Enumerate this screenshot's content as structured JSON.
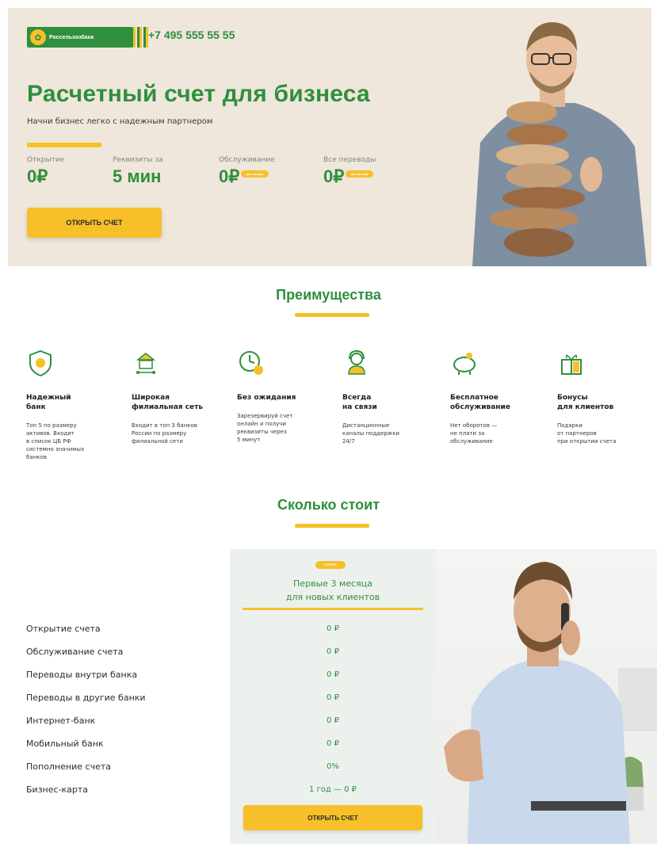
{
  "colors": {
    "brand_green": "#2f8f3c",
    "accent_yellow": "#f7c02a",
    "hero_bg": "#efe6dc",
    "panel_bg": "#edf1ee"
  },
  "header": {
    "logo_text": "Россельхозбанк",
    "phone": "+7 495 555 55 55"
  },
  "hero": {
    "title": "Расчетный счет для бизнеса",
    "subtitle": "Начни бизнес легко с надежным партнером",
    "stats": [
      {
        "label": "Открытие",
        "value": "0₽",
        "badge": ""
      },
      {
        "label": "Реквизиты за",
        "value": "5 мин",
        "badge": ""
      },
      {
        "label": "Обслуживание",
        "value": "0₽",
        "badge": "три месяца"
      },
      {
        "label": "Все переводы",
        "value": "0₽",
        "badge": "три месяца"
      }
    ],
    "button": "ОТКРЫТЬ СЧЕТ"
  },
  "advantages": {
    "title": "Преимущества",
    "items": [
      {
        "icon": "shield-icon",
        "title": "Надежный\nбанк",
        "text": "Топ 5 по размеру\nактивов. Входит\nв список ЦБ РФ\nсистемно значимых\nбанков"
      },
      {
        "icon": "bank-network-icon",
        "title": "Широкая\nфилиальная сеть",
        "text": "Входит в топ 3 банков\nРоссии по размеру\nфилиальной сети"
      },
      {
        "icon": "clock-icon",
        "title": "Без ожидания",
        "text": "Зарезервируй счет\nонлайн и получи\nреквизиты через\n5 минут"
      },
      {
        "icon": "support-headset-icon",
        "title": "Всегда\nна связи",
        "text": "Дистанционные\nканалы поддержки\n24/7"
      },
      {
        "icon": "piggy-bank-icon",
        "title": "Бесплатное\nобслуживание",
        "text": "Нет оборотов —\nне плати за\nобслуживание"
      },
      {
        "icon": "gift-icon",
        "title": "Бонусы\nдля клиентов",
        "text": "Подарки\nот партнеров\nпри открытии счета"
      }
    ]
  },
  "pricing": {
    "title": "Сколько стоит",
    "badge": "новое",
    "column_title_line1": "Первые 3 месяца",
    "column_title_line2": "для новых клиентов",
    "rows": [
      {
        "label": "Открытие счета",
        "value": "0 ₽"
      },
      {
        "label": "Обслуживание счета",
        "value": "0 ₽"
      },
      {
        "label": "Переводы внутри банка",
        "value": "0 ₽"
      },
      {
        "label": "Переводы в другие банки",
        "value": "0 ₽"
      },
      {
        "label": "Интернет-банк",
        "value": "0 ₽"
      },
      {
        "label": "Мобильный банк",
        "value": "0 ₽"
      },
      {
        "label": "Пополнение счета",
        "value": "0%"
      },
      {
        "label": "Бизнес-карта",
        "value": "1 год — 0 ₽"
      }
    ],
    "button": "ОТКРЫТЬ СЧЕТ"
  }
}
